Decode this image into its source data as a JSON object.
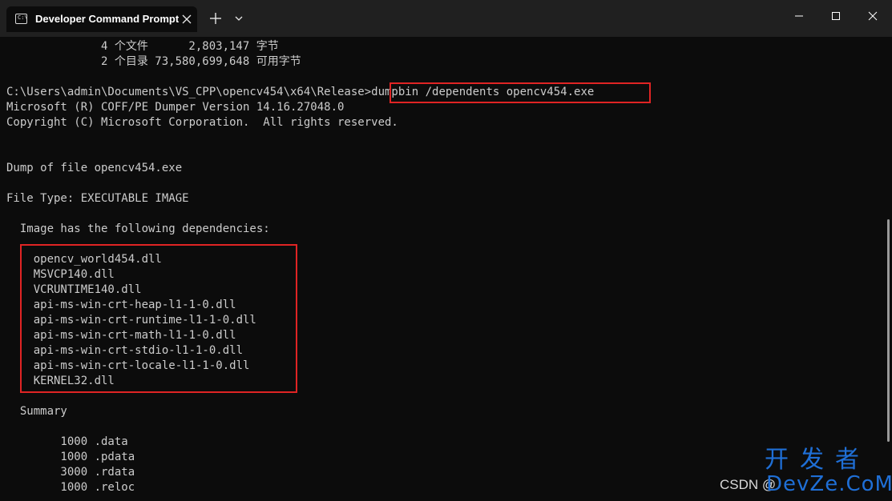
{
  "titlebar": {
    "tab_title": "Developer Command Prompt",
    "tab_icon": "command-prompt-icon",
    "close_tab_icon": "close-icon",
    "new_tab_label": "+",
    "dropdown_icon": "chevron-down-icon",
    "window_buttons": [
      "minimize-icon",
      "maximize-icon",
      "close-icon"
    ]
  },
  "console": {
    "lines": [
      "              4 个文件      2,803,147 字节",
      "              2 个目录 73,580,699,648 可用字节",
      "",
      "C:\\Users\\admin\\Documents\\VS_CPP\\opencv454\\x64\\Release>dumpbin /dependents opencv454.exe",
      "Microsoft (R) COFF/PE Dumper Version 14.16.27048.0",
      "Copyright (C) Microsoft Corporation.  All rights reserved.",
      "",
      "",
      "Dump of file opencv454.exe",
      "",
      "File Type: EXECUTABLE IMAGE",
      "",
      "  Image has the following dependencies:",
      "",
      "    opencv_world454.dll",
      "    MSVCP140.dll",
      "    VCRUNTIME140.dll",
      "    api-ms-win-crt-heap-l1-1-0.dll",
      "    api-ms-win-crt-runtime-l1-1-0.dll",
      "    api-ms-win-crt-math-l1-1-0.dll",
      "    api-ms-win-crt-stdio-l1-1-0.dll",
      "    api-ms-win-crt-locale-l1-1-0.dll",
      "    KERNEL32.dll",
      "",
      "  Summary",
      "",
      "        1000 .data",
      "        1000 .pdata",
      "        3000 .rdata",
      "        1000 .reloc"
    ]
  },
  "colors": {
    "console_bg": "#0c0c0c",
    "console_text": "#cccccc",
    "titlebar_bg": "#202020",
    "highlight_border": "#e02424",
    "watermark_blue": "#1f6fd6"
  },
  "watermark": {
    "csdn": "CSDN @",
    "logo_cn": "开发者",
    "logo_en": "DevZe.CoM"
  }
}
